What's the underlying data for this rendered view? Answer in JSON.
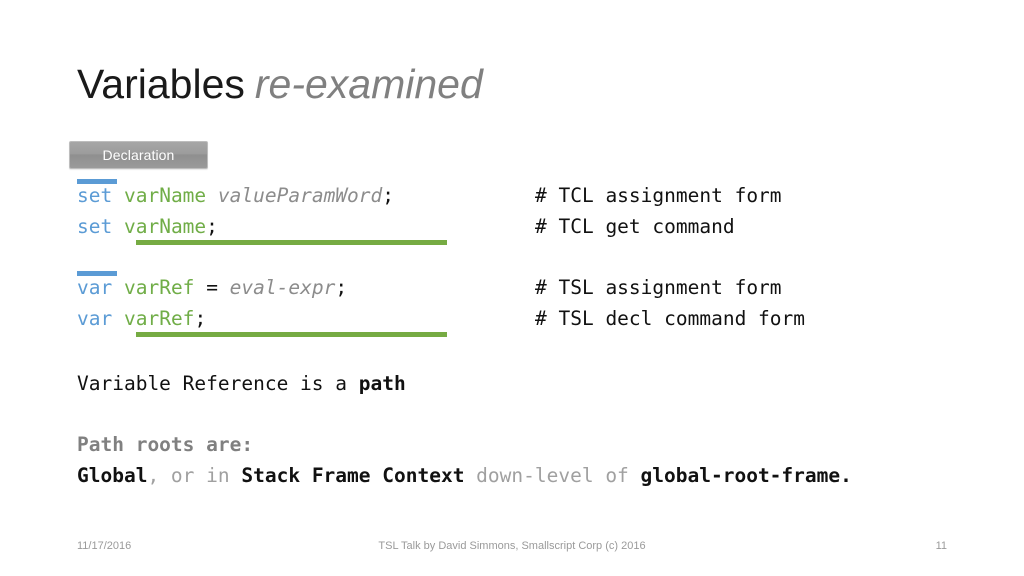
{
  "slide": {
    "title_main": "Variables",
    "title_sub": "re-examined",
    "badge_label": "Declaration"
  },
  "code_blocks": [
    {
      "id": "tcl-block",
      "rows": [
        {
          "keyword": "set",
          "space1": " ",
          "name": "varName",
          "space2": " ",
          "italic": "valueParamWord",
          "operator": "",
          "terminator": ";",
          "comment": "# TCL assignment form"
        },
        {
          "keyword": "set",
          "space1": " ",
          "name": "varName",
          "space2": "",
          "italic": "",
          "operator": "",
          "terminator": ";",
          "comment": "# TCL get command"
        }
      ]
    },
    {
      "id": "tsl-block",
      "rows": [
        {
          "keyword": "var",
          "space1": " ",
          "name": "varRef",
          "space2": " ",
          "italic": "eval-expr",
          "operator": "= ",
          "terminator": ";",
          "comment": "# TSL assignment form"
        },
        {
          "keyword": "var",
          "space1": " ",
          "name": "varRef",
          "space2": "",
          "italic": "",
          "operator": "",
          "terminator": ";",
          "comment": "# TSL decl command form"
        }
      ]
    }
  ],
  "statements": {
    "path_line": {
      "plain": "Variable Reference is a ",
      "bold": "path"
    },
    "roots_heading": "Path roots are:",
    "global_line": {
      "part1_bold": "Global",
      "part2_gray": ", or in ",
      "part3_bold": "Stack Frame Context",
      "part4_gray": " down-level of ",
      "part5_bold": "global-root-frame."
    }
  },
  "footer": {
    "date": "11/17/2016",
    "center": "TSL Talk by David Simmons, Smallscript Corp (c) 2016",
    "page": "11"
  },
  "colors": {
    "keyword_blue": "#5b9bd5",
    "name_green": "#70ad47",
    "bar_green": "#76ab43",
    "italic_gray": "#8c8c8c",
    "text_black": "#111111",
    "muted_gray": "#a0a0a0",
    "badge_gray": "#9c9c9c",
    "footer_gray": "#9a9a9a"
  }
}
